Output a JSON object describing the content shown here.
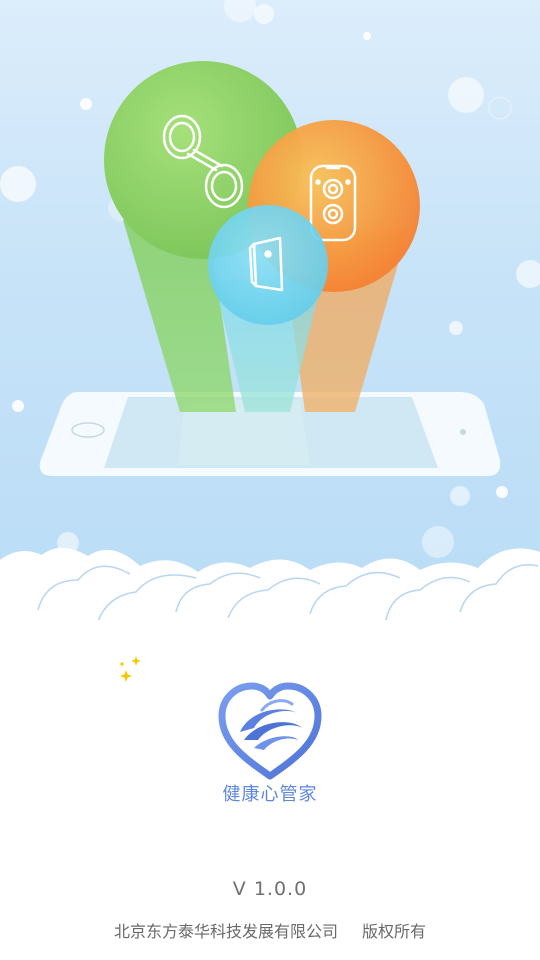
{
  "splash": {
    "app_name": "健康心管家",
    "version": "V 1.0.0",
    "company": "北京东方泰华科技发展有限公司",
    "rights": "版权所有"
  },
  "colors": {
    "sky": "#c7e3f8",
    "green_bubble": "#8fd460",
    "orange_bubble": "#f79a3e",
    "blue_bubble": "#6ad2ee",
    "brand_blue": "#5d86df"
  },
  "icons": [
    "dumbbell-icon",
    "camera-device-icon",
    "mobile-device-icon",
    "heart-logo-icon",
    "sparkle-icon"
  ]
}
